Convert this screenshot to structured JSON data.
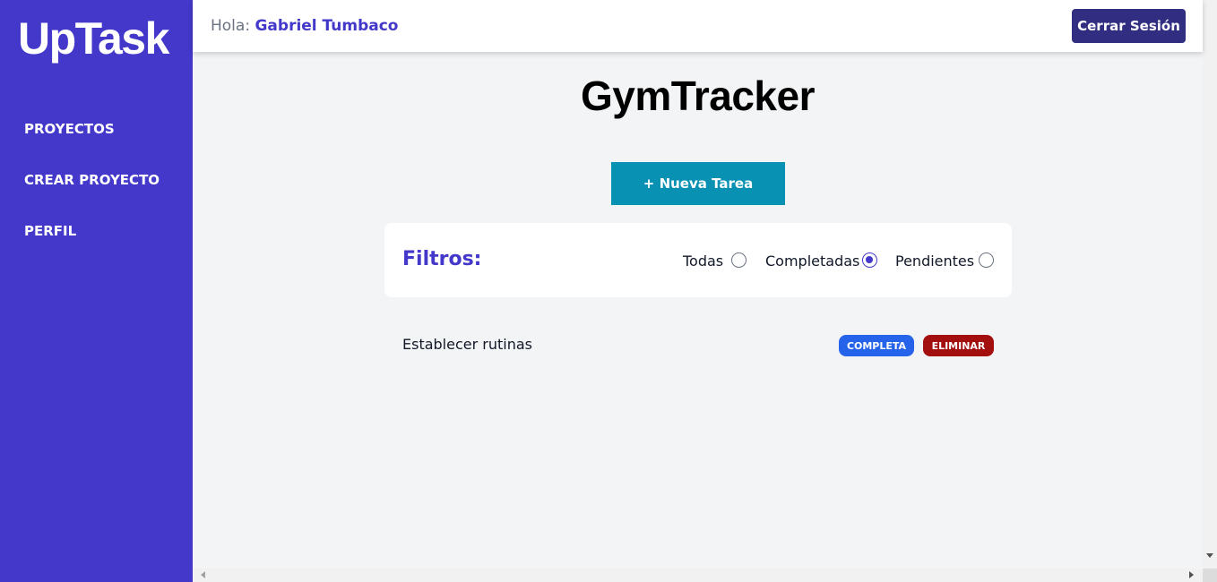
{
  "sidebar": {
    "logo": "UpTask",
    "items": [
      {
        "label": "Proyectos"
      },
      {
        "label": "Crear Proyecto"
      },
      {
        "label": "Perfil"
      }
    ]
  },
  "header": {
    "greeting_prefix": "Hola:",
    "username": "Gabriel Tumbaco",
    "logout_label": "Cerrar Sesión"
  },
  "project": {
    "title": "GymTracker",
    "new_task_label": "+ Nueva Tarea"
  },
  "filters": {
    "title": "Filtros:",
    "options": [
      {
        "label": "Todas",
        "checked": false
      },
      {
        "label": "Completadas",
        "checked": true
      },
      {
        "label": "Pendientes",
        "checked": false
      }
    ]
  },
  "tasks": [
    {
      "name": "Establecer rutinas",
      "status_label": "Completa",
      "delete_label": "Eliminar"
    }
  ],
  "colors": {
    "sidebar_bg": "#4338ca",
    "accent": "#4338ca",
    "logout_bg": "#312e81",
    "new_task_bg": "#0891b2",
    "complete_badge": "#2563eb",
    "delete_badge": "#a30f0f"
  }
}
